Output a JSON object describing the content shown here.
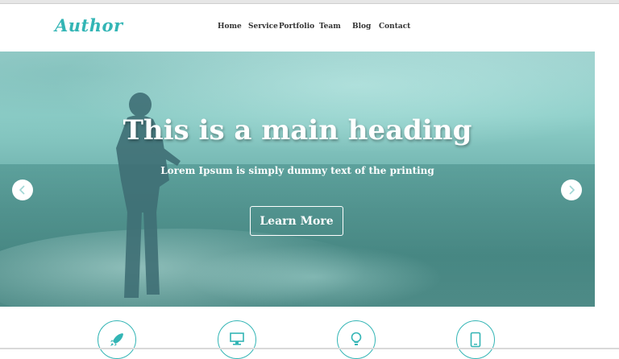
{
  "brand": {
    "logo": "Author",
    "accent": "#33b5b5"
  },
  "nav": {
    "items": [
      {
        "label": "Home"
      },
      {
        "label": "Service"
      },
      {
        "label": "Portfolio"
      },
      {
        "label": "Team"
      },
      {
        "label": "Blog"
      },
      {
        "label": "Contact"
      }
    ]
  },
  "hero": {
    "heading": "This is a main heading",
    "subheading": "Lorem Ipsum is simply dummy text of the printing",
    "cta_label": "Learn More",
    "prev_icon": "chevron-left-icon",
    "next_icon": "chevron-right-icon"
  },
  "features": {
    "icons": [
      "rocket-icon",
      "monitor-icon",
      "lightbulb-icon",
      "tablet-icon"
    ]
  }
}
